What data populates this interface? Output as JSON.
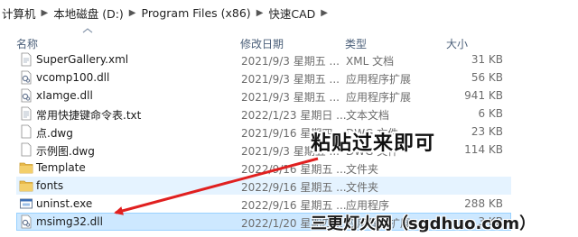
{
  "breadcrumb": {
    "items": [
      "计算机",
      "本地磁盘 (D:)",
      "Program Files (x86)",
      "快速CAD"
    ],
    "separator": "▶"
  },
  "columns": {
    "name": "名称",
    "date": "修改日期",
    "type": "类型",
    "size": "大小"
  },
  "files": [
    {
      "name": "SuperGallery.xml",
      "date": "2021/9/3 星期五 ...",
      "type": "XML 文档",
      "size": "31 KB",
      "icon": "xml-file-icon"
    },
    {
      "name": "vcomp100.dll",
      "date": "2021/9/3 星期五 ...",
      "type": "应用程序扩展",
      "size": "56 KB",
      "icon": "dll-file-icon"
    },
    {
      "name": "xIamge.dll",
      "date": "2021/9/3 星期五 ...",
      "type": "应用程序扩展",
      "size": "941 KB",
      "icon": "dll-file-icon"
    },
    {
      "name": "常用快捷键命令表.txt",
      "date": "2022/1/23 星期日 ...",
      "type": "文本文档",
      "size": "6 KB",
      "icon": "text-file-icon"
    },
    {
      "name": "点.dwg",
      "date": "2021/9/16 星期四 ...",
      "type": "DWG 文件",
      "size": "23 KB",
      "icon": "dwg-file-icon"
    },
    {
      "name": "示例图.dwg",
      "date": "2021/9/3 星期五 ...",
      "type": "DWG 文件",
      "size": "114 KB",
      "icon": "dwg-file-icon"
    },
    {
      "name": "Template",
      "date": "2022/9/16 星期五 ...",
      "type": "文件夹",
      "size": "",
      "icon": "folder-icon"
    },
    {
      "name": "fonts",
      "date": "2022/9/16 星期五 ...",
      "type": "文件夹",
      "size": "",
      "icon": "folder-icon",
      "state": "hover"
    },
    {
      "name": "uninst.exe",
      "date": "2022/9/16 星期五 ...",
      "type": "应用程序",
      "size": "288 KB",
      "icon": "exe-file-icon"
    },
    {
      "name": "msimg32.dll",
      "date": "2022/1/20 星期四 ...",
      "type": "应用程序扩展",
      "size": "3 KB",
      "icon": "dll-file-icon",
      "state": "selected"
    }
  ],
  "annotation": {
    "text": "粘贴过来即可",
    "arrow_color": "#e02020"
  },
  "watermark": "三更灯火网（sgdhuo.com）",
  "colors": {
    "selected_bg": "#cde8ff",
    "selected_border": "#99d1ff",
    "hover_bg": "#e5f3ff",
    "header_text": "#4c607a",
    "folder": "#e8b94a"
  }
}
